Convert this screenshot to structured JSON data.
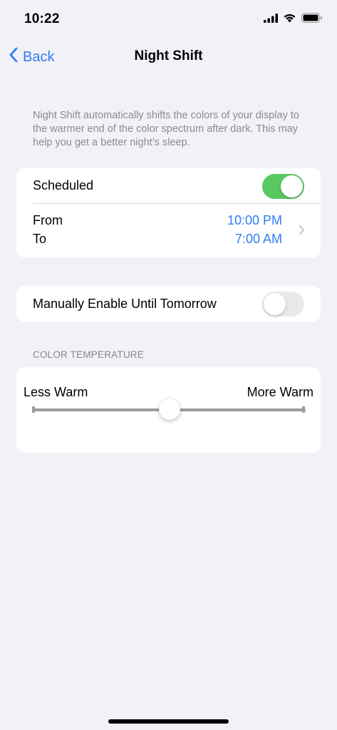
{
  "status_bar": {
    "time": "10:22",
    "icons": [
      "cellular-signal-icon",
      "wifi-icon",
      "battery-icon"
    ]
  },
  "nav": {
    "back_label": "Back",
    "title": "Night Shift"
  },
  "description": "Night Shift automatically shifts the colors of your display to the warmer end of the color spectrum after dark. This may help you get a better night’s sleep.",
  "schedule": {
    "label": "Scheduled",
    "enabled": true,
    "from_label": "From",
    "from_value": "10:00 PM",
    "to_label": "To",
    "to_value": "7:00 AM"
  },
  "manual": {
    "label": "Manually Enable Until Tomorrow",
    "enabled": false
  },
  "color_temperature": {
    "header": "COLOR TEMPERATURE",
    "min_label": "Less Warm",
    "max_label": "More Warm",
    "value": 0.5
  },
  "colors": {
    "accent": "#2f7cf6",
    "toggle_on": "#5ac860",
    "background": "#f2f1f7"
  }
}
